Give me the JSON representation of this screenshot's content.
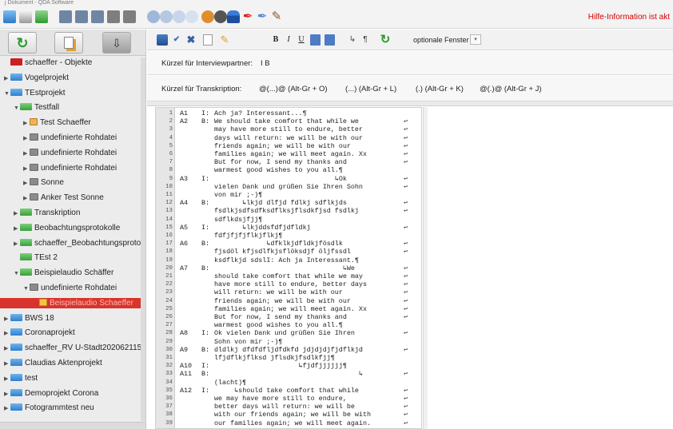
{
  "window": {
    "title": "j Dokument - QDA Software",
    "hint": "Hilfe-Information ist akt"
  },
  "toolbar": {
    "optional_label": "optionale Fenster"
  },
  "tree": [
    {
      "label": "schaeffer - Objekte",
      "depth": 0,
      "arrow": "",
      "icon": "red",
      "selected": false
    },
    {
      "label": "Vogelprojekt",
      "depth": 0,
      "arrow": "right",
      "icon": "blue",
      "selected": false
    },
    {
      "label": "TEstprojekt",
      "depth": 0,
      "arrow": "down",
      "icon": "blue",
      "selected": false
    },
    {
      "label": "Testfall",
      "depth": 1,
      "arrow": "down",
      "icon": "green",
      "selected": false
    },
    {
      "label": "Test Schaeffer",
      "depth": 2,
      "arrow": "right",
      "icon": "orange",
      "selected": false
    },
    {
      "label": "undefinierte Rohdatei",
      "depth": 2,
      "arrow": "right",
      "icon": "gray",
      "selected": false
    },
    {
      "label": "undefinierte Rohdatei",
      "depth": 2,
      "arrow": "right",
      "icon": "gray",
      "selected": false
    },
    {
      "label": "undefinierte Rohdatei",
      "depth": 2,
      "arrow": "right",
      "icon": "gray",
      "selected": false
    },
    {
      "label": "Sonne",
      "depth": 2,
      "arrow": "right",
      "icon": "gray",
      "selected": false
    },
    {
      "label": "Anker Test Sonne",
      "depth": 2,
      "arrow": "right",
      "icon": "gray",
      "selected": false
    },
    {
      "label": "Transkription",
      "depth": 1,
      "arrow": "right",
      "icon": "green",
      "selected": false
    },
    {
      "label": "Beobachtungsprotokolle",
      "depth": 1,
      "arrow": "right",
      "icon": "green",
      "selected": false
    },
    {
      "label": "schaeffer_Beobachtungsprotok",
      "depth": 1,
      "arrow": "right",
      "icon": "green",
      "selected": false
    },
    {
      "label": "TEst 2",
      "depth": 1,
      "arrow": "",
      "icon": "green",
      "selected": false
    },
    {
      "label": "Beispielaudio Schäffer",
      "depth": 1,
      "arrow": "down",
      "icon": "green",
      "selected": false
    },
    {
      "label": "undefinierte Rohdatei",
      "depth": 2,
      "arrow": "down",
      "icon": "gray",
      "selected": false
    },
    {
      "label": "Beispielaudio Schaeffer",
      "depth": 3,
      "arrow": "",
      "icon": "yellow",
      "selected": true
    },
    {
      "label": "BWS 18",
      "depth": 0,
      "arrow": "right",
      "icon": "blue",
      "selected": false
    },
    {
      "label": "Coronaprojekt",
      "depth": 0,
      "arrow": "right",
      "icon": "blue",
      "selected": false
    },
    {
      "label": "schaeffer_RV U-Stadt2020621158",
      "depth": 0,
      "arrow": "right",
      "icon": "blue",
      "selected": false
    },
    {
      "label": "Claudias Aktenprojekt",
      "depth": 0,
      "arrow": "right",
      "icon": "blue",
      "selected": false
    },
    {
      "label": "test",
      "depth": 0,
      "arrow": "right",
      "icon": "blue",
      "selected": false
    },
    {
      "label": "Demoprojekt Corona",
      "depth": 0,
      "arrow": "right",
      "icon": "blue",
      "selected": false
    },
    {
      "label": "Fotogrammtest neu",
      "depth": 0,
      "arrow": "right",
      "icon": "blue",
      "selected": false
    }
  ],
  "fields": {
    "partner_label": "Kürzel für Interviewpartner:",
    "partner_value": "I  B",
    "transcription_label": "Kürzel für Transkription:",
    "shortcuts": [
      "@(...)@ (Alt-Gr + O)",
      "(...) (Alt-Gr + L)",
      "(.) (Alt-Gr + K)",
      "@(.)@ (Alt-Gr + J)"
    ]
  },
  "transcript": [
    {
      "n": "1",
      "id": "A1",
      "spk": "I:",
      "text": "Ach ja? Interessant...¶",
      "cont": false
    },
    {
      "n": "2",
      "id": "A2",
      "spk": "B:",
      "text": "We should take comfort that while we",
      "cont": true
    },
    {
      "n": "3",
      "id": "",
      "spk": "",
      "text": "may have more still to endure, better",
      "cont": true
    },
    {
      "n": "4",
      "id": "",
      "spk": "",
      "text": "days will return: we will be with our",
      "cont": true
    },
    {
      "n": "5",
      "id": "",
      "spk": "",
      "text": "friends again; we will be with our",
      "cont": true
    },
    {
      "n": "6",
      "id": "",
      "spk": "",
      "text": "families again; we will meet again. Xx",
      "cont": true
    },
    {
      "n": "7",
      "id": "",
      "spk": "",
      "text": "But for now, I send my thanks and",
      "cont": true
    },
    {
      "n": "8",
      "id": "",
      "spk": "",
      "text": "warmest good wishes to you all.¶",
      "cont": false
    },
    {
      "n": "9",
      "id": "A3",
      "spk": "I:",
      "text": "                              ↳Ok",
      "cont": true
    },
    {
      "n": "10",
      "id": "",
      "spk": "",
      "text": "vielen Dank und grüßen Sie Ihren Sohn",
      "cont": true
    },
    {
      "n": "11",
      "id": "",
      "spk": "",
      "text": "von mir ;-)¶",
      "cont": false
    },
    {
      "n": "12",
      "id": "A4",
      "spk": "B:",
      "text": "       ↳lkjd dlfjd fdlkj sdflkjds",
      "cont": true
    },
    {
      "n": "13",
      "id": "",
      "spk": "",
      "text": "fsdlkjsdfsdfksdflksjflsdkfjsd fsdlkj",
      "cont": true
    },
    {
      "n": "14",
      "id": "",
      "spk": "",
      "text": "sdflkdsjfjj¶",
      "cont": false
    },
    {
      "n": "15",
      "id": "A5",
      "spk": "I:",
      "text": "       ↳lkjddsfdfjdfldkj",
      "cont": true
    },
    {
      "n": "16",
      "id": "",
      "spk": "",
      "text": "fdfjfjfjflkjflkj¶",
      "cont": false
    },
    {
      "n": "17",
      "id": "A6",
      "spk": "B:",
      "text": "             ↳dfklkjdfldkjfösdlk",
      "cont": true
    },
    {
      "n": "18",
      "id": "",
      "spk": "",
      "text": "fjsdöl kfjsdlfkjsflöksdjf öljfssdl",
      "cont": true
    },
    {
      "n": "19",
      "id": "",
      "spk": "",
      "text": "ksdflkjd sdslI: Ach ja Interessant.¶",
      "cont": false
    },
    {
      "n": "20",
      "id": "A7",
      "spk": "B:",
      "text": "                                ↳We",
      "cont": true
    },
    {
      "n": "21",
      "id": "",
      "spk": "",
      "text": "should take comfort that while we may",
      "cont": true
    },
    {
      "n": "22",
      "id": "",
      "spk": "",
      "text": "have more still to endure, better days",
      "cont": true
    },
    {
      "n": "23",
      "id": "",
      "spk": "",
      "text": "will return: we will be with our",
      "cont": true
    },
    {
      "n": "24",
      "id": "",
      "spk": "",
      "text": "friends again; we will be with our",
      "cont": true
    },
    {
      "n": "25",
      "id": "",
      "spk": "",
      "text": "families again; we will meet again. Xx",
      "cont": true
    },
    {
      "n": "26",
      "id": "",
      "spk": "",
      "text": "But for now, I send my thanks and",
      "cont": true
    },
    {
      "n": "27",
      "id": "",
      "spk": "",
      "text": "warmest good wishes to you all.¶",
      "cont": false
    },
    {
      "n": "28",
      "id": "A8",
      "spk": "I:",
      "text": "Ok vielen Dank und grüßen Sie Ihren",
      "cont": true
    },
    {
      "n": "29",
      "id": "",
      "spk": "",
      "text": "Sohn von mir ;-)¶",
      "cont": false
    },
    {
      "n": "30",
      "id": "A9",
      "spk": "B:",
      "text": "dldlkj dfdfdfljdfdkfd jdjdjdjfjdflkjd",
      "cont": true
    },
    {
      "n": "31",
      "id": "",
      "spk": "",
      "text": "lfjdflkjflksd jflsdkjfsdlkfjj¶",
      "cont": false
    },
    {
      "n": "32",
      "id": "A10",
      "spk": "I:",
      "text": "                     ↳fjdfjjjjjj¶",
      "cont": false
    },
    {
      "n": "33",
      "id": "A11",
      "spk": "B:",
      "text": "                                    ↳",
      "cont": true
    },
    {
      "n": "34",
      "id": "",
      "spk": "",
      "text": "(lacht)¶",
      "cont": false
    },
    {
      "n": "35",
      "id": "A12",
      "spk": "I:",
      "text": "     ↳should take comfort that while",
      "cont": true
    },
    {
      "n": "36",
      "id": "",
      "spk": "",
      "text": "we may have more still to endure,",
      "cont": true
    },
    {
      "n": "37",
      "id": "",
      "spk": "",
      "text": "better days will return: we will be",
      "cont": true
    },
    {
      "n": "38",
      "id": "",
      "spk": "",
      "text": "with our friends again; we will be with",
      "cont": true
    },
    {
      "n": "39",
      "id": "",
      "spk": "",
      "text": "our families again; we will meet again.",
      "cont": true
    }
  ],
  "symbols": {
    "continuation": "↩"
  }
}
